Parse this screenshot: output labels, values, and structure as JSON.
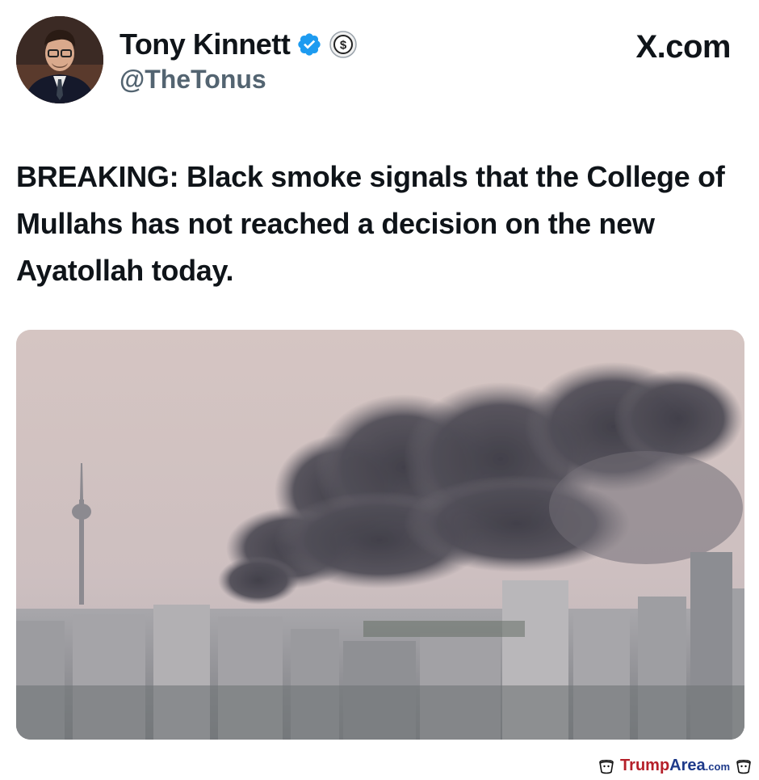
{
  "post": {
    "author_name": "Tony Kinnett",
    "handle": "@TheTonus",
    "site_label": "X.com",
    "text": "BREAKING: Black smoke signals that the College of Mullahs has not reached a decision on the new Ayatollah today."
  },
  "icons": {
    "verified": "verified-check-icon",
    "subscription": "dollar-circle-icon",
    "watermark": "mascot-icon"
  },
  "colors": {
    "verified_blue": "#1d9bf0",
    "handle_gray": "#536471",
    "watermark_red": "#b5202a",
    "watermark_blue": "#1e3a8a"
  },
  "watermark": {
    "part1": "Trump",
    "part2": "Area",
    "part3": ".com"
  }
}
